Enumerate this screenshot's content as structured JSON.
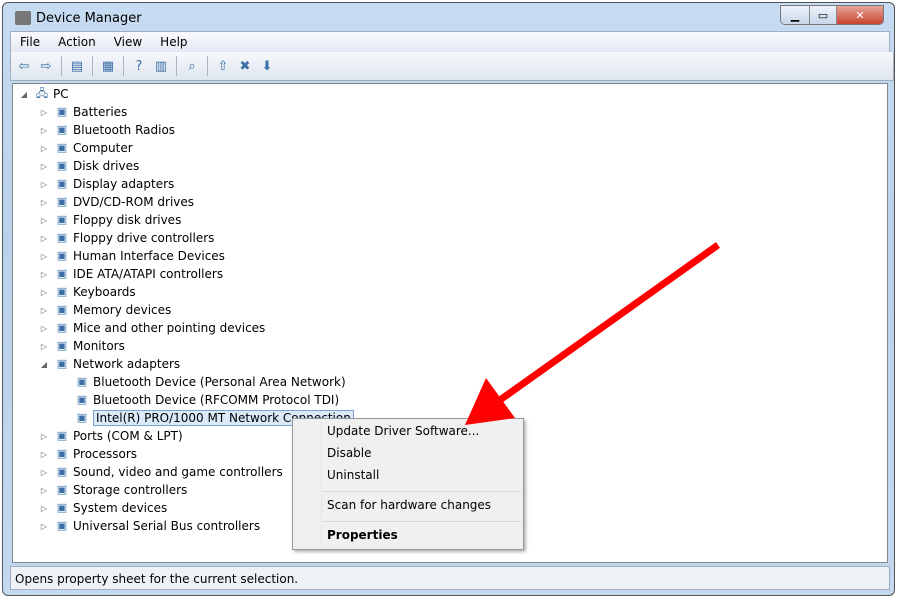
{
  "window": {
    "title": "Device Manager",
    "minimize": "▁",
    "maximize": "▭",
    "close": "✕"
  },
  "menu": [
    "File",
    "Action",
    "View",
    "Help"
  ],
  "toolbar": [
    {
      "icon": "back-icon",
      "glyph": "⇦"
    },
    {
      "icon": "forward-icon",
      "glyph": "⇨"
    },
    {
      "icon": "show-hide-console-tree-icon",
      "glyph": "▤"
    },
    {
      "icon": "properties-icon",
      "glyph": "▦"
    },
    {
      "icon": "help-icon",
      "glyph": "?"
    },
    {
      "icon": "show-action-pane-icon",
      "glyph": "▥"
    },
    {
      "icon": "scan-hardware-icon",
      "glyph": "⌕"
    },
    {
      "icon": "update-driver-icon",
      "glyph": "⇧"
    },
    {
      "icon": "uninstall-icon",
      "glyph": "✖"
    },
    {
      "icon": "disable-icon",
      "glyph": "⬇"
    }
  ],
  "tree": {
    "root": "PC",
    "items": [
      "Batteries",
      "Bluetooth Radios",
      "Computer",
      "Disk drives",
      "Display adapters",
      "DVD/CD-ROM drives",
      "Floppy disk drives",
      "Floppy drive controllers",
      "Human Interface Devices",
      "IDE ATA/ATAPI controllers",
      "Keyboards",
      "Memory devices",
      "Mice and other pointing devices",
      "Monitors",
      "Network adapters",
      "Ports (COM & LPT)",
      "Processors",
      "Sound, video and game controllers",
      "Storage controllers",
      "System devices",
      "Universal Serial Bus controllers"
    ],
    "network_children": [
      "Bluetooth Device (Personal Area Network)",
      "Bluetooth Device (RFCOMM Protocol TDI)",
      "Intel(R) PRO/1000 MT Network Connection"
    ]
  },
  "context_menu": {
    "update": "Update Driver Software...",
    "disable": "Disable",
    "uninstall": "Uninstall",
    "scan": "Scan for hardware changes",
    "properties": "Properties"
  },
  "status": "Opens property sheet for the current selection.",
  "annotation_color": "#ff0000"
}
